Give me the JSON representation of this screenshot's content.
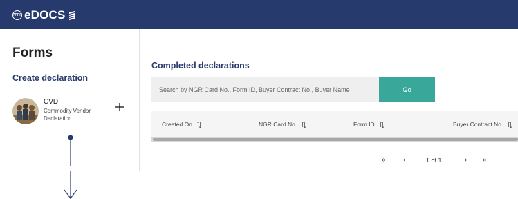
{
  "header": {
    "logo_badge": "PPPR",
    "logo_text": "eDOCS",
    "logo_icon": "wheat-icon",
    "bg_color": "#263a6d"
  },
  "sidebar": {
    "title": "Forms",
    "create_title": "Create declaration",
    "item": {
      "name": "CVD",
      "description": "Commodity Vendor Declaration",
      "action_icon": "plus-icon"
    }
  },
  "main": {
    "title": "Completed declarations",
    "search": {
      "placeholder": "Search by NGR Card No., Form ID, Buyer Contract No., Buyer Name",
      "value": ""
    },
    "go_label": "Go",
    "accent": "#3aa79b",
    "columns": [
      "Created On",
      "NGR Card No.",
      "Form ID",
      "Buyer Contract No."
    ],
    "pagination": {
      "first": "«",
      "prev": "‹",
      "info": "1 of 1",
      "next": "›",
      "last": "»"
    }
  }
}
